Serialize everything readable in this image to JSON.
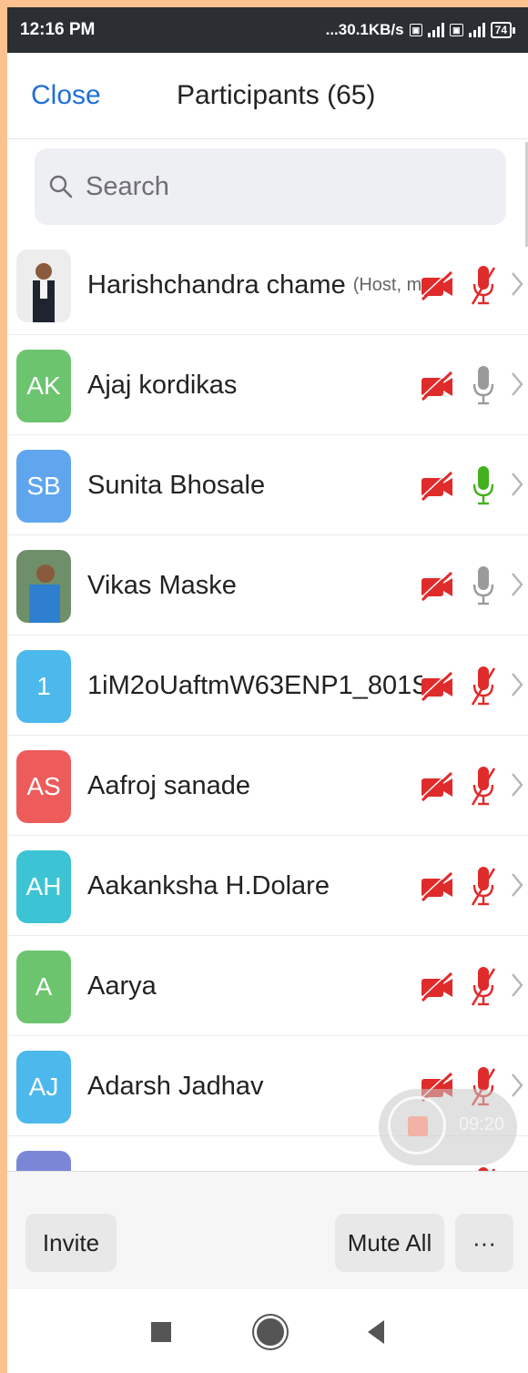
{
  "status_bar": {
    "time": "12:16 PM",
    "speed": "...30.1KB/s",
    "network1": "4G+",
    "battery": "74"
  },
  "header": {
    "close_label": "Close",
    "title": "Participants (65)"
  },
  "search": {
    "placeholder": "Search"
  },
  "participants": [
    {
      "name": "Harishchandra chame",
      "tag": "(Host, me)",
      "initials": "",
      "color": "#ffffff",
      "photo": true,
      "video": "off",
      "mic": "muted"
    },
    {
      "name": "Ajaj kordikas",
      "initials": "AK",
      "color": "#6cc46e",
      "video": "off",
      "mic": "on-idle"
    },
    {
      "name": "Sunita Bhosale",
      "initials": "SB",
      "color": "#5fa6ee",
      "video": "off",
      "mic": "on-active"
    },
    {
      "name": "Vikas Maske",
      "initials": "",
      "color": "#ffffff",
      "photo": true,
      "video": "off",
      "mic": "on-idle"
    },
    {
      "name": "1iM2oUaftmW63ENP1_801S...",
      "initials": "1",
      "color": "#4cb8ec",
      "video": "off",
      "mic": "muted"
    },
    {
      "name": "Aafroj sanade",
      "initials": "AS",
      "color": "#ee5b5b",
      "video": "off",
      "mic": "muted"
    },
    {
      "name": "Aakanksha H.Dolare",
      "initials": "AH",
      "color": "#3cc4d4",
      "video": "off",
      "mic": "muted"
    },
    {
      "name": "Aarya",
      "initials": "A",
      "color": "#6cc46e",
      "video": "off",
      "mic": "muted"
    },
    {
      "name": "Adarsh Jadhav",
      "initials": "AJ",
      "color": "#4cb8ec",
      "video": "off",
      "mic": "muted"
    },
    {
      "name": "",
      "initials": "",
      "color": "#7b86d6",
      "video": "off",
      "mic": "muted"
    }
  ],
  "floating_recorder": {
    "time": "09:20"
  },
  "footer": {
    "invite_label": "Invite",
    "mute_all_label": "Mute All",
    "more_label": "···"
  },
  "colors": {
    "accent": "#1f6fd6",
    "muted_red": "#e02b2b",
    "mic_active": "#43b01f",
    "mic_idle": "#9a9a9a"
  }
}
